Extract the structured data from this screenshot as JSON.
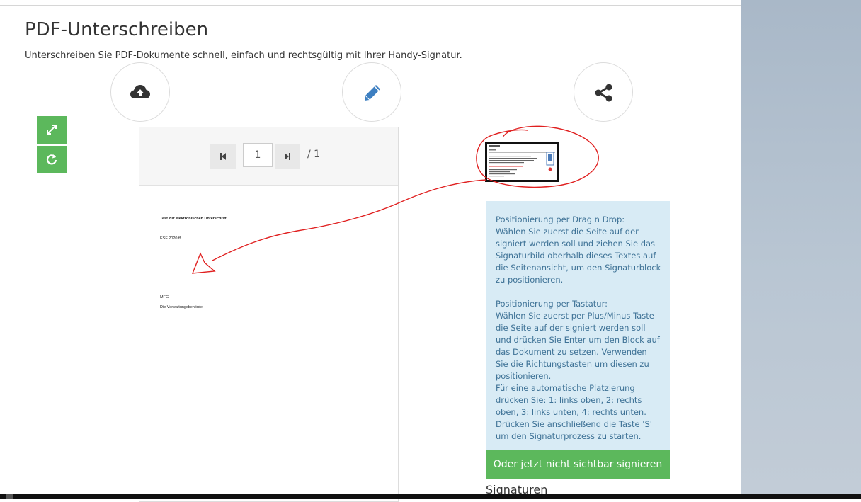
{
  "page": {
    "title": "PDF-Unterschreiben",
    "subtitle": "Unterschreiben Sie PDF-Dokumente schnell, einfach und rechtsgültig mit Ihrer Handy-Signatur."
  },
  "steps": [
    {
      "icon": "cloud-upload-icon"
    },
    {
      "icon": "pencil-icon"
    },
    {
      "icon": "share-icon"
    }
  ],
  "toolbar_left": [
    {
      "icon": "expand-icon"
    },
    {
      "icon": "refresh-icon"
    }
  ],
  "viewer": {
    "current_page": "1",
    "total_pages": "/ 1"
  },
  "document": {
    "heading": "Test zur elektronischen Unterschrift",
    "ref": "ESF 2020 ff.",
    "greeting": "MFG",
    "sender": "Die Verwaltungsbehörde"
  },
  "info": {
    "dragdrop_title": "Positionierung per Drag n Drop:",
    "dragdrop_text": "Wählen Sie zuerst die Seite auf der signiert werden soll und ziehen Sie das Signaturbild oberhalb dieses Textes auf die Seitenansicht, um den Signaturblock zu positionieren.",
    "keyboard_title": "Positionierung per Tastatur:",
    "keyboard_text": "Wählen Sie zuerst per Plus/Minus Taste die Seite auf der signiert werden soll und drücken Sie Enter um den Block auf das Dokument zu setzen. Verwenden Sie die Richtungstasten um diesen zu positionieren.",
    "auto_text": "Für eine automatische Platzierung drücken Sie: 1: links oben, 2: rechts oben, 3: links unten, 4: rechts unten.",
    "start_text": "Drücken Sie anschließend die Taste 'S' um den Signaturprozess zu starten."
  },
  "actions": {
    "sign_invisible_label": "Oder jetzt nicht sichtbar signieren"
  },
  "signatures": {
    "heading": "Signaturen"
  },
  "colors": {
    "green": "#5cb85c",
    "info_bg": "#d8ebf5",
    "info_text": "#3e7296",
    "annotation": "#e02020"
  }
}
